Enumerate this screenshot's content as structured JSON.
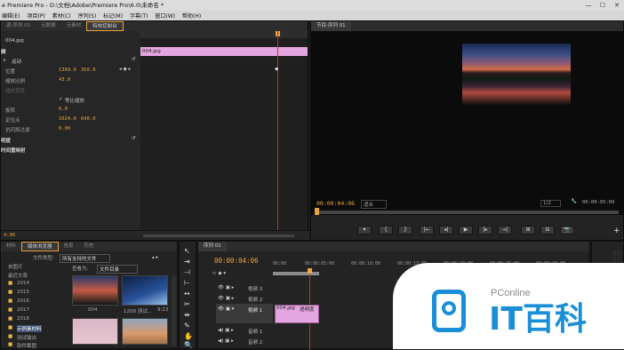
{
  "window": {
    "title": "e Premiere Pro - D:\\文档\\Adobe\\Premiere Pro\\6.0\\未命名 *",
    "min": "—",
    "max": "☐",
    "close": "✕"
  },
  "menu": [
    "编辑(E)",
    "项目(P)",
    "素材(C)",
    "序列(S)",
    "标记(M)",
    "字幕(T)",
    "窗口(W)",
    "帮助(H)"
  ],
  "effect_controls": {
    "tabs": [
      "源:序列 01",
      "元数据",
      "元素材",
      "特效控制台"
    ],
    "clip_name": "004.jpg",
    "timeline_clip": "004.jpg",
    "section_video": "频",
    "section_motion": "运动",
    "props": [
      {
        "label": "位置",
        "v1": "1369.0",
        "v2": "350.0"
      },
      {
        "label": "缩放比例",
        "v1": "43.0",
        "v2": ""
      },
      {
        "label": "缩放宽度",
        "v1": "",
        "v2": ""
      },
      {
        "label": "等比缩放",
        "v1": "",
        "v2": ""
      },
      {
        "label": "旋转",
        "v1": "0.0",
        "v2": ""
      },
      {
        "label": "定位点",
        "v1": "1024.0",
        "v2": "640.0"
      },
      {
        "label": "抗闪烁过滤",
        "v1": "0.00",
        "v2": ""
      }
    ],
    "uniform_checkbox": "✓",
    "opacity": "明度",
    "time_remap": "时间重映射",
    "timecode": "4:06"
  },
  "program": {
    "title": "节目:序列 01",
    "timecode_left": "00:00:04:06",
    "fit": "适合",
    "quality": "1/2",
    "timecode_right": "00:00:05:00",
    "controls": [
      "▾",
      "{",
      "}",
      "|←",
      "◂|",
      "▶",
      "|▸",
      "→|",
      "⊞",
      "⊟",
      "📷"
    ],
    "add": "+"
  },
  "project": {
    "tabs": [
      "材料",
      "媒体浏览器",
      "信息",
      "历史"
    ],
    "file_type_label": "文件类型:",
    "file_type_value": "所有支持的文件",
    "view_label": "查看为:",
    "view_value": "文件目录",
    "folders": [
      "自图片",
      "最近文章",
      "2014",
      "2015",
      "2016",
      "2017",
      "2018",
      "示例素材料",
      "测试输出",
      "软件截图"
    ],
    "thumbs": [
      {
        "name": "004",
        "meta": ""
      },
      {
        "name": "1208 测试...",
        "meta": "9:23"
      },
      {
        "name": "",
        "meta": ""
      },
      {
        "name": "",
        "meta": ""
      }
    ]
  },
  "timeline": {
    "tab": "序列 01",
    "timecode": "00:00:04:06",
    "ruler": [
      "00:00",
      "00:00:05:00",
      "00:00:10:00",
      "00:00:15:00",
      "00:00:20:00",
      "00:00:25:00",
      "00:00:30:00",
      "00:00:35:00"
    ],
    "tracks": [
      {
        "name": "视频 3"
      },
      {
        "name": "视频 2"
      },
      {
        "name": "视频 1"
      },
      {
        "name": "音频 1"
      },
      {
        "name": "音频 2"
      }
    ],
    "clip_label": "004.jpg",
    "clip_suffix": "透明度"
  },
  "watermark": {
    "brand": "PConline",
    "text": "IT百科"
  },
  "colors": {
    "accent": "#e9a43d",
    "clip": "#e4a6e0",
    "playhead": "#c8302a"
  }
}
